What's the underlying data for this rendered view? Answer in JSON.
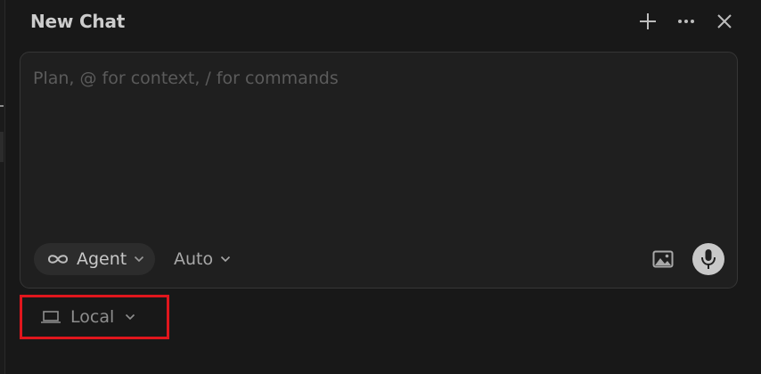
{
  "header": {
    "title": "New Chat",
    "icons": {
      "new_chat": "plus-icon",
      "more": "ellipsis-icon",
      "close": "close-icon"
    }
  },
  "composer": {
    "placeholder": "Plan, @ for context, / for commands",
    "value": "",
    "mode_label": "Agent",
    "mode_icon": "infinity-icon",
    "model_label": "Auto",
    "attach_icon": "image-icon",
    "voice_icon": "microphone-icon"
  },
  "environment": {
    "label": "Local",
    "icon": "laptop-icon",
    "highlight_color": "#e0161d"
  }
}
